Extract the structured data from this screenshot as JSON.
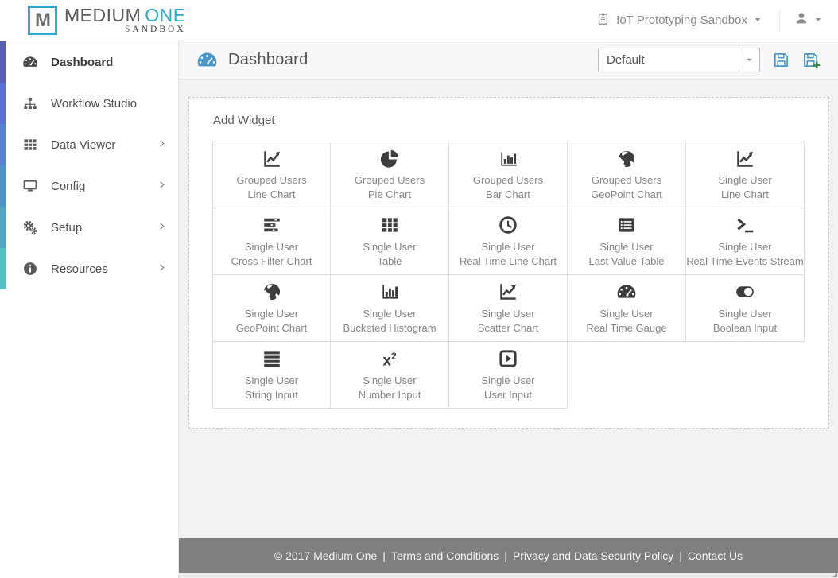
{
  "header": {
    "logo": {
      "mark": "M",
      "brand_primary": "MEDIUM",
      "brand_secondary": "ONE",
      "subtitle": "SANDBOX"
    },
    "workspace": {
      "icon": "clipboard-icon",
      "label": "IoT Prototyping Sandbox",
      "caret": "caret-down-icon"
    },
    "user_menu": {
      "icon": "user-icon",
      "caret": "caret-down-icon"
    }
  },
  "sidebar": {
    "items": [
      {
        "label": "Dashboard",
        "icon": "gauge-icon",
        "active": true,
        "has_submenu": false,
        "accent": "#5960ae"
      },
      {
        "label": "Workflow Studio",
        "icon": "sitemap-icon",
        "active": false,
        "has_submenu": false,
        "accent": "#5b72ce"
      },
      {
        "label": "Data Viewer",
        "icon": "table-icon",
        "active": false,
        "has_submenu": true,
        "accent": "#5682cc"
      },
      {
        "label": "Config",
        "icon": "desktop-icon",
        "active": false,
        "has_submenu": true,
        "accent": "#5293c7"
      },
      {
        "label": "Setup",
        "icon": "gears-icon",
        "active": false,
        "has_submenu": true,
        "accent": "#54a6c4"
      },
      {
        "label": "Resources",
        "icon": "info-icon",
        "active": false,
        "has_submenu": true,
        "accent": "#57bec3"
      }
    ]
  },
  "page": {
    "title": "Dashboard",
    "title_icon": "gauge-icon",
    "dashboard_select": {
      "value": "Default",
      "caret": "caret-down-icon"
    },
    "actions": [
      {
        "name": "save-dashboard",
        "icon": "save-icon"
      },
      {
        "name": "save-dashboard-new",
        "icon": "save-plus-icon"
      }
    ]
  },
  "panel": {
    "title": "Add Widget",
    "widgets": [
      {
        "line1": "Grouped Users",
        "line2": "Line Chart",
        "icon": "line-chart-icon"
      },
      {
        "line1": "Grouped Users",
        "line2": "Pie Chart",
        "icon": "pie-chart-icon"
      },
      {
        "line1": "Grouped Users",
        "line2": "Bar Chart",
        "icon": "bar-chart-icon"
      },
      {
        "line1": "Grouped Users",
        "line2": "GeoPoint Chart",
        "icon": "globe-icon"
      },
      {
        "line1": "Single User",
        "line2": "Line Chart",
        "icon": "line-chart-icon"
      },
      {
        "line1": "Single User",
        "line2": "Cross Filter Chart",
        "icon": "cross-filter-icon"
      },
      {
        "line1": "Single User",
        "line2": "Table",
        "icon": "table-icon"
      },
      {
        "line1": "Single User",
        "line2": "Real Time Line Chart",
        "icon": "clock-icon"
      },
      {
        "line1": "Single User",
        "line2": "Last Value Table",
        "icon": "list-icon"
      },
      {
        "line1": "Single User",
        "line2": "Real Time Events Stream",
        "icon": "terminal-icon"
      },
      {
        "line1": "Single User",
        "line2": "GeoPoint Chart",
        "icon": "globe-icon"
      },
      {
        "line1": "Single User",
        "line2": "Bucketed Histogram",
        "icon": "histogram-icon"
      },
      {
        "line1": "Single User",
        "line2": "Scatter Chart",
        "icon": "scatter-chart-icon"
      },
      {
        "line1": "Single User",
        "line2": "Real Time Gauge",
        "icon": "gauge-icon"
      },
      {
        "line1": "Single User",
        "line2": "Boolean Input",
        "icon": "toggle-icon"
      },
      {
        "line1": "Single User",
        "line2": "String Input",
        "icon": "align-justify-icon"
      },
      {
        "line1": "Single User",
        "line2": "Number Input",
        "icon": "number-input-icon"
      },
      {
        "line1": "Single User",
        "line2": "User Input",
        "icon": "play-square-icon"
      }
    ]
  },
  "footer": {
    "copyright": "© 2017 Medium One",
    "separator": "|",
    "links": [
      "Terms and Conditions",
      "Privacy and Data Security Policy",
      "Contact Us"
    ]
  }
}
